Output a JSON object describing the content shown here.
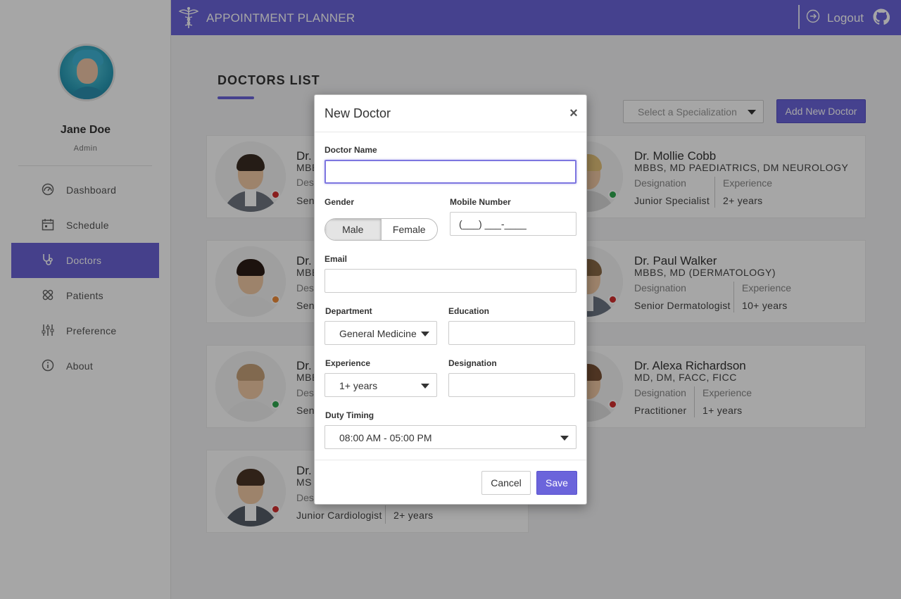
{
  "app": {
    "title": "APPOINTMENT PLANNER",
    "logout_label": "Logout"
  },
  "user": {
    "name": "Jane Doe",
    "role": "Admin"
  },
  "sidebar": {
    "items": [
      {
        "label": "Dashboard",
        "icon": "dashboard-icon"
      },
      {
        "label": "Schedule",
        "icon": "calendar-icon"
      },
      {
        "label": "Doctors",
        "icon": "stethoscope-icon",
        "active": true
      },
      {
        "label": "Patients",
        "icon": "bandage-icon"
      },
      {
        "label": "Preference",
        "icon": "sliders-icon"
      },
      {
        "label": "About",
        "icon": "info-icon"
      }
    ]
  },
  "content": {
    "title": "DOCTORS LIST",
    "specialization_placeholder": "Select a Specialization",
    "add_button": "Add New Doctor",
    "labels": {
      "designation": "Designation",
      "experience": "Experience"
    },
    "cards": [
      {
        "name": "Dr.",
        "qual": "MBB",
        "designation": "Sen",
        "experience": "",
        "status": "#d32f2f"
      },
      {
        "name": "Dr. Mollie Cobb",
        "qual": "MBBS, MD PAEDIATRICS, DM NEUROLOGY",
        "designation": "Junior Specialist",
        "experience": "2+ years",
        "status": "#2fa84f"
      },
      {
        "name": "Dr.",
        "qual": "MBB",
        "designation": "Sen",
        "experience": "",
        "status": "#f08c3a"
      },
      {
        "name": "Dr. Paul Walker",
        "qual": "MBBS, MD (DERMATOLOGY)",
        "designation": "Senior Dermatologist",
        "experience": "10+ years",
        "status": "#d32f2f"
      },
      {
        "name": "Dr.",
        "qual": "MBB",
        "designation": "Sen",
        "experience": "",
        "status": "#2fa84f"
      },
      {
        "name": "Dr. Alexa Richardson",
        "qual": "MD, DM, FACC, FICC",
        "designation": "Practitioner",
        "experience": "1+ years",
        "status": "#d32f2f"
      },
      {
        "name": "Dr.",
        "qual": "MS",
        "designation": "Junior Cardiologist",
        "experience": "2+ years",
        "status": "#d32f2f"
      }
    ]
  },
  "modal": {
    "title": "New Doctor",
    "doctor_name_label": "Doctor Name",
    "doctor_name_value": "",
    "gender_label": "Gender",
    "gender_options": [
      "Male",
      "Female"
    ],
    "gender_selected": "Male",
    "mobile_label": "Mobile Number",
    "mobile_mask": "(___) ___-____",
    "email_label": "Email",
    "email_value": "",
    "department_label": "Department",
    "department_value": "General Medicine",
    "education_label": "Education",
    "education_value": "",
    "experience_label": "Experience",
    "experience_value": "1+ years",
    "designation_label": "Designation",
    "designation_value": "",
    "duty_label": "Duty Timing",
    "duty_value": "08:00 AM - 05:00 PM",
    "cancel_label": "Cancel",
    "save_label": "Save"
  },
  "colors": {
    "accent": "#6b64db",
    "online": "#2fa84f",
    "busy": "#d32f2f",
    "away": "#f08c3a"
  }
}
